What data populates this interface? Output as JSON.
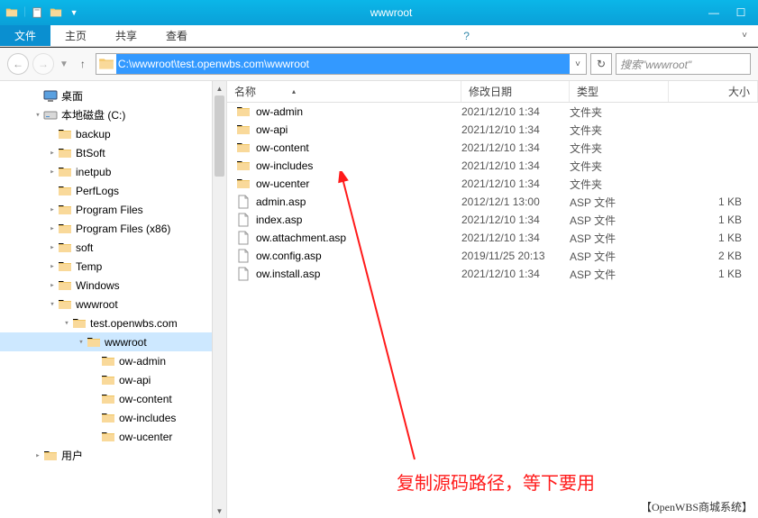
{
  "window": {
    "title": "wwwroot"
  },
  "ribbon": {
    "file": "文件",
    "tabs": [
      "主页",
      "共享",
      "查看"
    ]
  },
  "address": {
    "path": "C:\\wwwroot\\test.openwbs.com\\wwwroot",
    "search_placeholder": "搜索\"wwwroot\""
  },
  "columns": {
    "name": "名称",
    "date": "修改日期",
    "type": "类型",
    "size": "大小"
  },
  "tree": [
    {
      "lvl": 1,
      "exp": "",
      "ico": "desktop",
      "label": "桌面"
    },
    {
      "lvl": 1,
      "exp": "▾",
      "ico": "disk",
      "label": "本地磁盘 (C:)"
    },
    {
      "lvl": 2,
      "exp": "",
      "ico": "folder",
      "label": "backup"
    },
    {
      "lvl": 2,
      "exp": "▸",
      "ico": "folder",
      "label": "BtSoft"
    },
    {
      "lvl": 2,
      "exp": "▸",
      "ico": "folder",
      "label": "inetpub"
    },
    {
      "lvl": 2,
      "exp": "",
      "ico": "folder",
      "label": "PerfLogs"
    },
    {
      "lvl": 2,
      "exp": "▸",
      "ico": "folder",
      "label": "Program Files"
    },
    {
      "lvl": 2,
      "exp": "▸",
      "ico": "folder",
      "label": "Program Files (x86)"
    },
    {
      "lvl": 2,
      "exp": "▸",
      "ico": "folder",
      "label": "soft"
    },
    {
      "lvl": 2,
      "exp": "▸",
      "ico": "folder",
      "label": "Temp"
    },
    {
      "lvl": 2,
      "exp": "▸",
      "ico": "folder",
      "label": "Windows"
    },
    {
      "lvl": 2,
      "exp": "▾",
      "ico": "folder",
      "label": "wwwroot"
    },
    {
      "lvl": 3,
      "exp": "▾",
      "ico": "folder",
      "label": "test.openwbs.com"
    },
    {
      "lvl": 4,
      "exp": "▾",
      "ico": "folder",
      "label": "wwwroot",
      "selected": true
    },
    {
      "lvl": 5,
      "exp": "",
      "ico": "folder",
      "label": "ow-admin"
    },
    {
      "lvl": 5,
      "exp": "",
      "ico": "folder",
      "label": "ow-api"
    },
    {
      "lvl": 5,
      "exp": "",
      "ico": "folder",
      "label": "ow-content"
    },
    {
      "lvl": 5,
      "exp": "",
      "ico": "folder",
      "label": "ow-includes"
    },
    {
      "lvl": 5,
      "exp": "",
      "ico": "folder",
      "label": "ow-ucenter"
    },
    {
      "lvl": 1,
      "exp": "▸",
      "ico": "folder",
      "label": "用户"
    }
  ],
  "files": [
    {
      "ico": "folder",
      "name": "ow-admin",
      "date": "2021/12/10 1:34",
      "type": "文件夹",
      "size": ""
    },
    {
      "ico": "folder",
      "name": "ow-api",
      "date": "2021/12/10 1:34",
      "type": "文件夹",
      "size": ""
    },
    {
      "ico": "folder",
      "name": "ow-content",
      "date": "2021/12/10 1:34",
      "type": "文件夹",
      "size": ""
    },
    {
      "ico": "folder",
      "name": "ow-includes",
      "date": "2021/12/10 1:34",
      "type": "文件夹",
      "size": ""
    },
    {
      "ico": "folder",
      "name": "ow-ucenter",
      "date": "2021/12/10 1:34",
      "type": "文件夹",
      "size": ""
    },
    {
      "ico": "file",
      "name": "admin.asp",
      "date": "2012/12/1 13:00",
      "type": "ASP 文件",
      "size": "1 KB"
    },
    {
      "ico": "file",
      "name": "index.asp",
      "date": "2021/12/10 1:34",
      "type": "ASP 文件",
      "size": "1 KB"
    },
    {
      "ico": "file",
      "name": "ow.attachment.asp",
      "date": "2021/12/10 1:34",
      "type": "ASP 文件",
      "size": "1 KB"
    },
    {
      "ico": "file",
      "name": "ow.config.asp",
      "date": "2019/11/25 20:13",
      "type": "ASP 文件",
      "size": "2 KB"
    },
    {
      "ico": "file",
      "name": "ow.install.asp",
      "date": "2021/12/10 1:34",
      "type": "ASP 文件",
      "size": "1 KB"
    }
  ],
  "annotation": "复制源码路径，等下要用",
  "watermark": "【OpenWBS商城系统】"
}
